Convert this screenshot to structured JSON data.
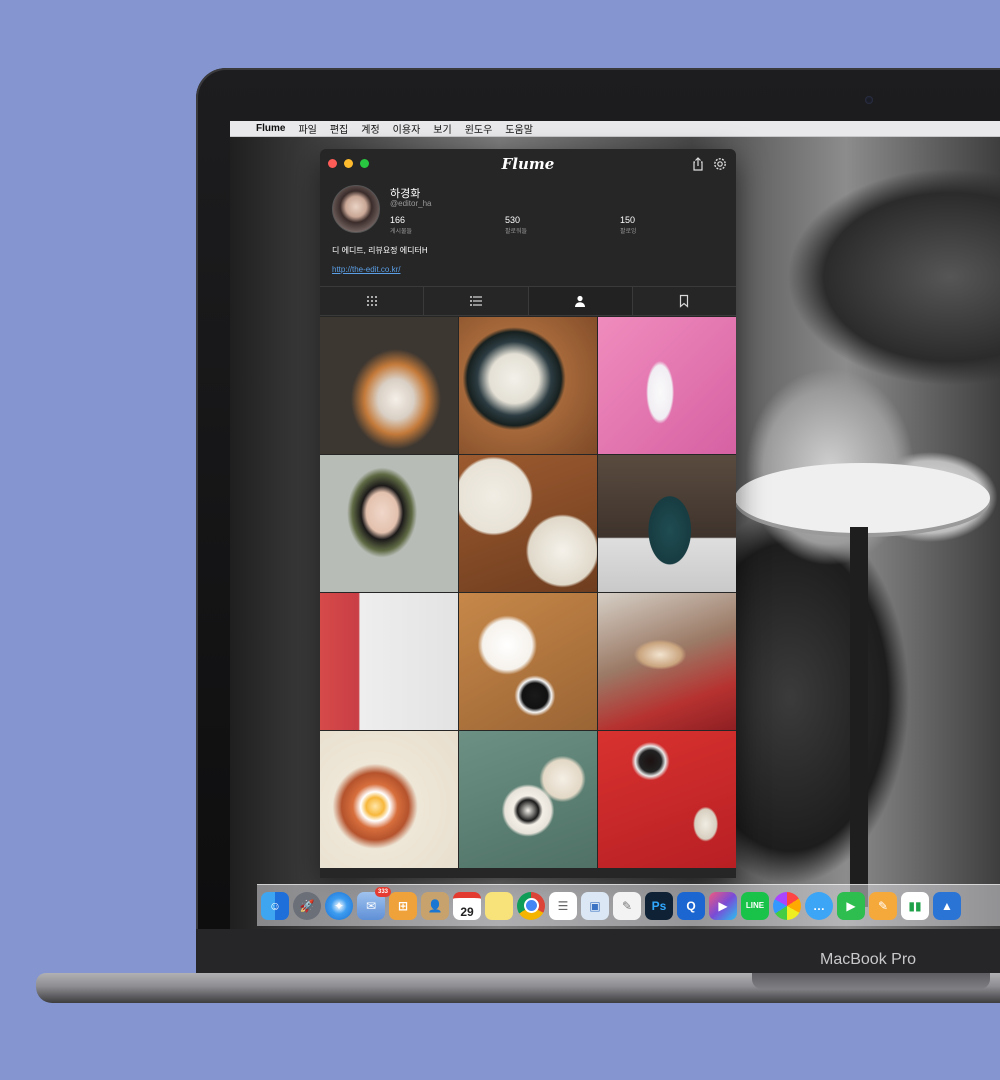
{
  "device": {
    "brand_label": "MacBook Pro"
  },
  "menubar": {
    "apple_icon": "",
    "app_name": "Flume",
    "items": [
      "파일",
      "편집",
      "계정",
      "이용자",
      "보기",
      "윈도우",
      "도움말"
    ]
  },
  "app": {
    "title": "Flume",
    "toolbar_icons": [
      "share-icon",
      "gear-icon"
    ]
  },
  "profile": {
    "name": "하경화",
    "handle": "@editor_ha",
    "stats": [
      {
        "value": "166",
        "label": "게시물들"
      },
      {
        "value": "530",
        "label": "팔로워들"
      },
      {
        "value": "150",
        "label": "팔로잉"
      }
    ],
    "bio": "디 에디트, 리뷰요정 에디터H",
    "link": "http://the-edit.co.kr/"
  },
  "tabs": [
    {
      "icon": "grid-icon",
      "active": false
    },
    {
      "icon": "list-icon",
      "active": false
    },
    {
      "icon": "person-icon",
      "active": true
    },
    {
      "icon": "bookmark-icon",
      "active": false
    }
  ],
  "photos": [
    "cat",
    "soup",
    "woman-pink-wall",
    "selfie-snow",
    "cake-table",
    "coffee-bag",
    "photo-studio",
    "cake-laptop",
    "wine-cork",
    "egg-rice",
    "coffee-desk",
    "red-desk"
  ],
  "dock": {
    "mail_badge": "333",
    "calendar_day": "29",
    "icons": [
      "finder-icon",
      "launchpad-icon",
      "safari-icon",
      "mail-icon",
      "calculator-icon",
      "contacts-icon",
      "calendar-icon",
      "notes-icon",
      "chrome-icon",
      "reminders-icon",
      "preview-icon",
      "textedit-icon",
      "photoshop-icon",
      "quicktime-icon",
      "final-cut-icon",
      "line-icon",
      "photos-icon",
      "messages-icon",
      "facetime-icon",
      "pages-icon",
      "numbers-icon",
      "keynote-icon"
    ]
  },
  "colors": {
    "background": "#8495cf",
    "window": "#262626",
    "link": "#5b9fe6",
    "close": "#fd5d56",
    "minimize": "#fdbb2d",
    "maximize": "#28c840"
  }
}
